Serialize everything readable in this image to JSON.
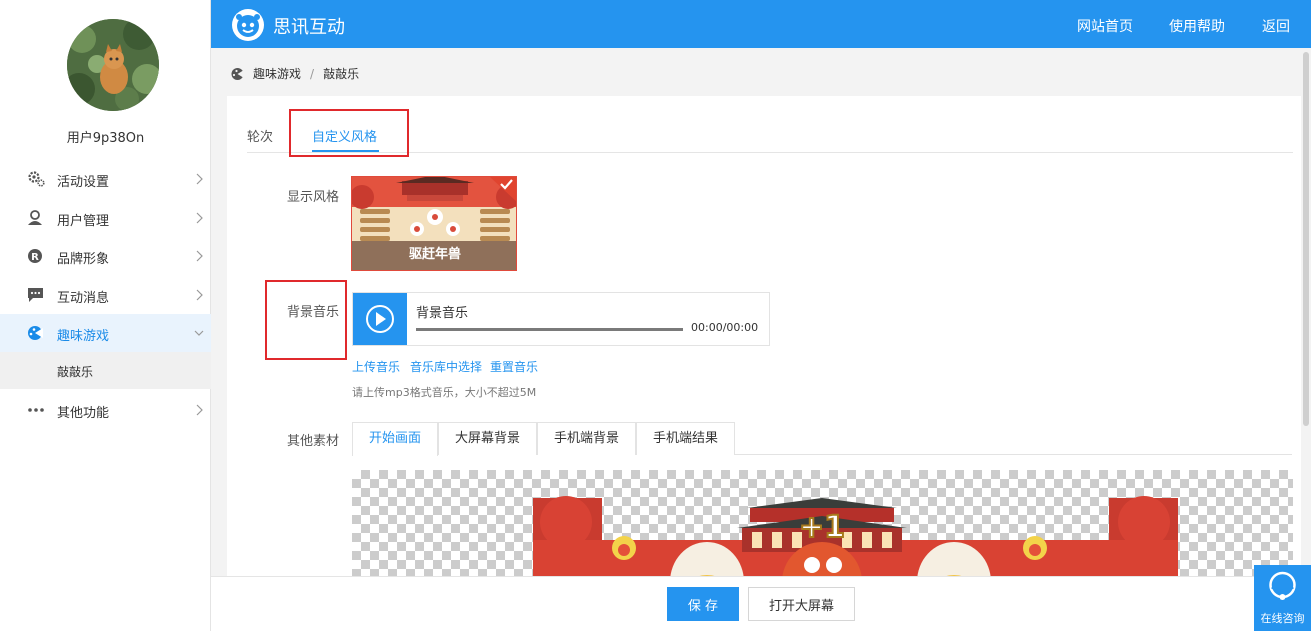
{
  "sidebar": {
    "username": "用户9p38On",
    "items": [
      {
        "label": "活动设置",
        "icon": "gear-icon"
      },
      {
        "label": "用户管理",
        "icon": "user-icon"
      },
      {
        "label": "品牌形象",
        "icon": "registered-icon"
      },
      {
        "label": "互动消息",
        "icon": "message-icon"
      },
      {
        "label": "趣味游戏",
        "icon": "game-icon"
      },
      {
        "label": "其他功能",
        "icon": "more-icon"
      }
    ],
    "sub_item": "敲敲乐"
  },
  "header": {
    "brand": "思讯互动",
    "links": [
      "网站首页",
      "使用帮助",
      "返回"
    ]
  },
  "breadcrumb": {
    "parent": "趣味游戏",
    "separator": "/",
    "current": "敲敲乐"
  },
  "tabs": {
    "round": "轮次",
    "custom_style": "自定义风格"
  },
  "form": {
    "display_style_label": "显示风格",
    "style_name": "驱赶年兽",
    "bg_music_label": "背景音乐",
    "audio_title": "背景音乐",
    "audio_time": "00:00/00:00",
    "upload_music": "上传音乐",
    "choose_library": "音乐库中选择",
    "reset_music": "重置音乐",
    "hint": "请上传mp3格式音乐，大小不超过5M",
    "other_assets_label": "其他素材",
    "asset_tabs": [
      "开始画面",
      "大屏幕背景",
      "手机端背景",
      "手机端结果"
    ],
    "preview_badge": "+1"
  },
  "footer": {
    "save": "保 存",
    "open_big_screen": "打开大屏幕"
  },
  "consult": {
    "label": "在线咨询"
  },
  "colors": {
    "primary": "#2594ef",
    "highlight_box": "#e0292c",
    "active_nav_bg": "#e9f3fd"
  }
}
